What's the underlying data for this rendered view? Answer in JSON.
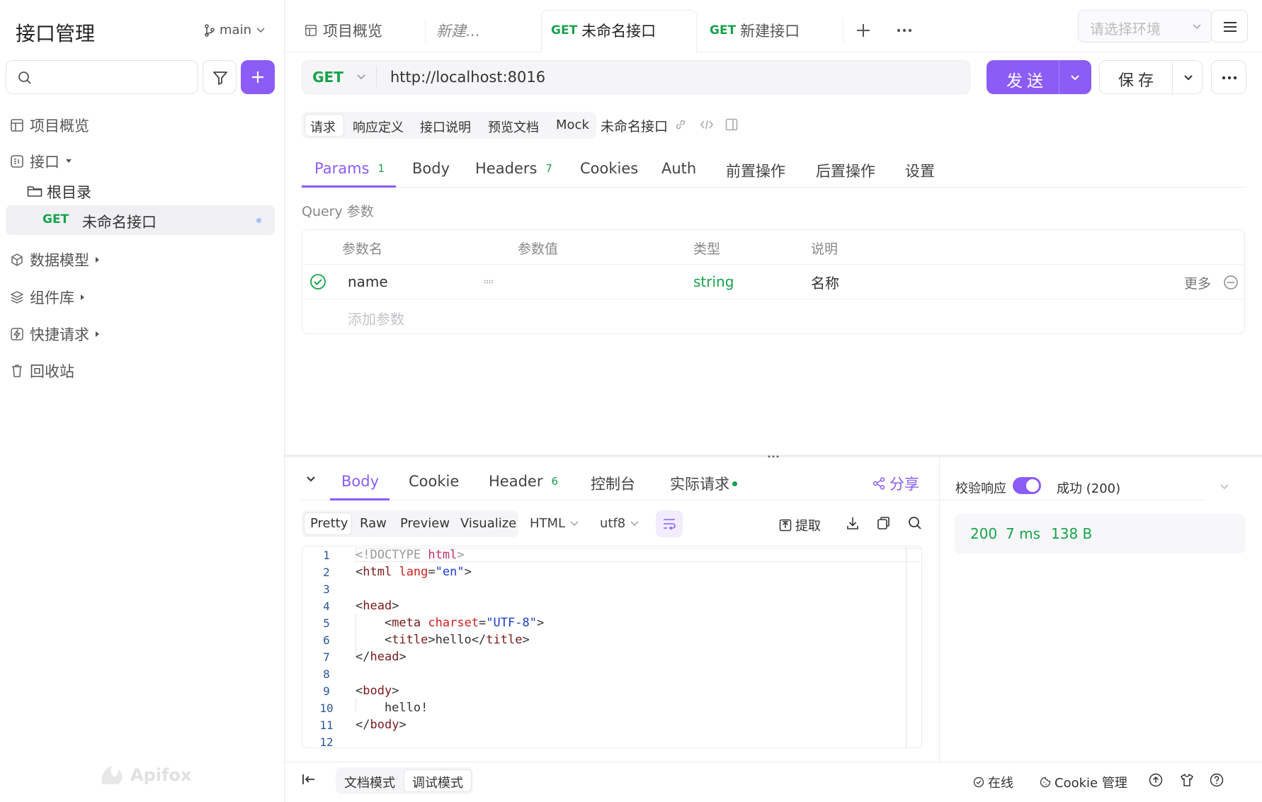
{
  "sidebar": {
    "title": "接口管理",
    "branch": "main",
    "nav": [
      {
        "label": "项目概览"
      },
      {
        "label": "接口"
      },
      {
        "label": "数据模型"
      },
      {
        "label": "组件库"
      },
      {
        "label": "快捷请求"
      },
      {
        "label": "回收站"
      }
    ],
    "root_folder": "根目录",
    "endpoint": {
      "method": "GET",
      "name": "未命名接口"
    },
    "watermark": "Apifox"
  },
  "tabs": [
    {
      "label": "项目概览"
    },
    {
      "label": "新建..."
    },
    {
      "method": "GET",
      "label": "未命名接口"
    },
    {
      "method": "GET",
      "label": "新建接口"
    }
  ],
  "env_placeholder": "请选择环境",
  "request": {
    "method": "GET",
    "url": "http://localhost:8016",
    "send_label": "发送",
    "save_label": "保存"
  },
  "sub_tabs": [
    "请求",
    "响应定义",
    "接口说明",
    "预览文档",
    "Mock"
  ],
  "endpoint_name": "未命名接口",
  "param_tabs": [
    {
      "label": "Params",
      "count": "1"
    },
    {
      "label": "Body"
    },
    {
      "label": "Headers",
      "count": "7"
    },
    {
      "label": "Cookies"
    },
    {
      "label": "Auth"
    },
    {
      "label": "前置操作"
    },
    {
      "label": "后置操作"
    },
    {
      "label": "设置"
    }
  ],
  "query_label": "Query 参数",
  "param_table": {
    "headers": [
      "参数名",
      "参数值",
      "类型",
      "说明"
    ],
    "rows": [
      {
        "name": "name",
        "value": "",
        "type": "string",
        "desc": "名称",
        "more": "更多"
      }
    ],
    "add_placeholder": "添加参数"
  },
  "response": {
    "tabs": [
      {
        "label": "Body"
      },
      {
        "label": "Cookie"
      },
      {
        "label": "Header",
        "count": "6"
      },
      {
        "label": "控制台"
      },
      {
        "label": "实际请求"
      }
    ],
    "share_label": "分享",
    "view_modes": [
      "Pretty",
      "Raw",
      "Preview",
      "Visualize"
    ],
    "format": "HTML",
    "encoding": "utf8",
    "extract_label": "提取",
    "code_lines": [
      "1",
      "2",
      "3",
      "4",
      "5",
      "6",
      "7",
      "8",
      "9",
      "10",
      "11",
      "12"
    ],
    "validate_label": "校验响应",
    "validate_status": "成功 (200)",
    "status_code": "200",
    "time": "7 ms",
    "size": "138 B"
  },
  "footer": {
    "doc_mode": "文档模式",
    "debug_mode": "调试模式",
    "online": "在线",
    "cookie_mgr": "Cookie 管理"
  },
  "colors": {
    "accent": "#8b5cf6",
    "get": "#17a34a"
  }
}
